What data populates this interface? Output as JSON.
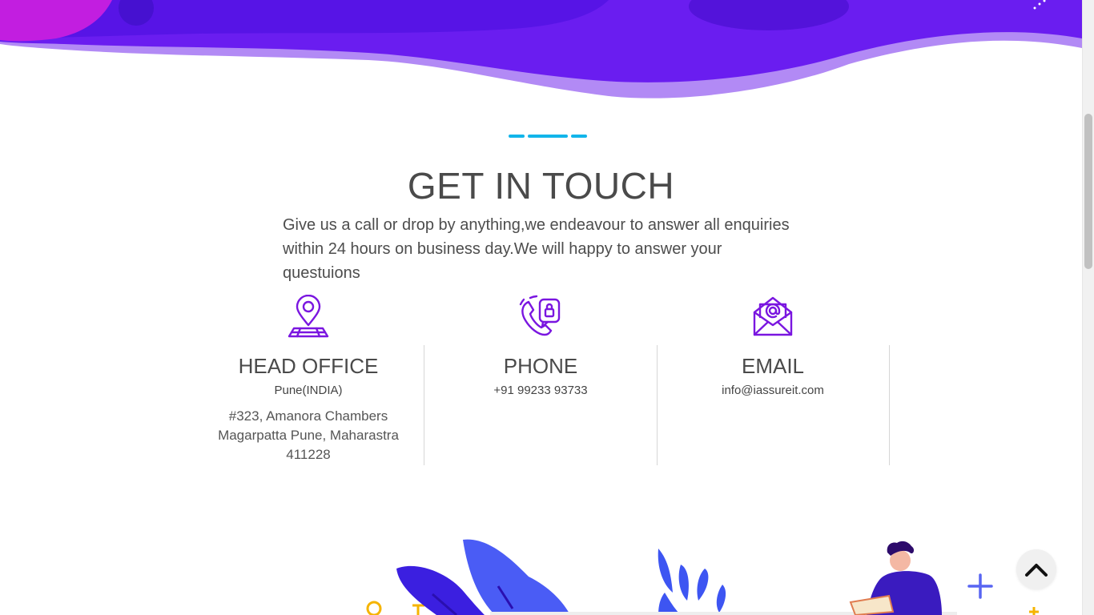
{
  "contact": {
    "title": "GET IN TOUCH",
    "intro": "Give us a call or drop by anything,we endeavour to answer all enquiries within 24 hours on business day.We will happy to answer your questuions",
    "head_office": {
      "heading": "HEAD OFFICE",
      "city": "Pune(INDIA)",
      "address_line1": "#323, Amanora Chambers",
      "address_line2": "Magarpatta Pune, Maharastra",
      "address_line3": "411228",
      "icon": "location-map-icon"
    },
    "phone": {
      "heading": "PHONE",
      "number": "+91 99233 93733",
      "icon": "phone-support-icon"
    },
    "email": {
      "heading": "EMAIL",
      "address": "info@iassureit.com",
      "icon": "email-envelope-icon"
    }
  },
  "back_to_top": {
    "icon": "chevron-up-icon"
  },
  "colors": {
    "accent": "#12b5ea",
    "icon_purple": "#7a16e0",
    "wave_dark": "#5a14e6",
    "wave_light": "#a97cf3",
    "heading_text": "#4a4a4a"
  }
}
